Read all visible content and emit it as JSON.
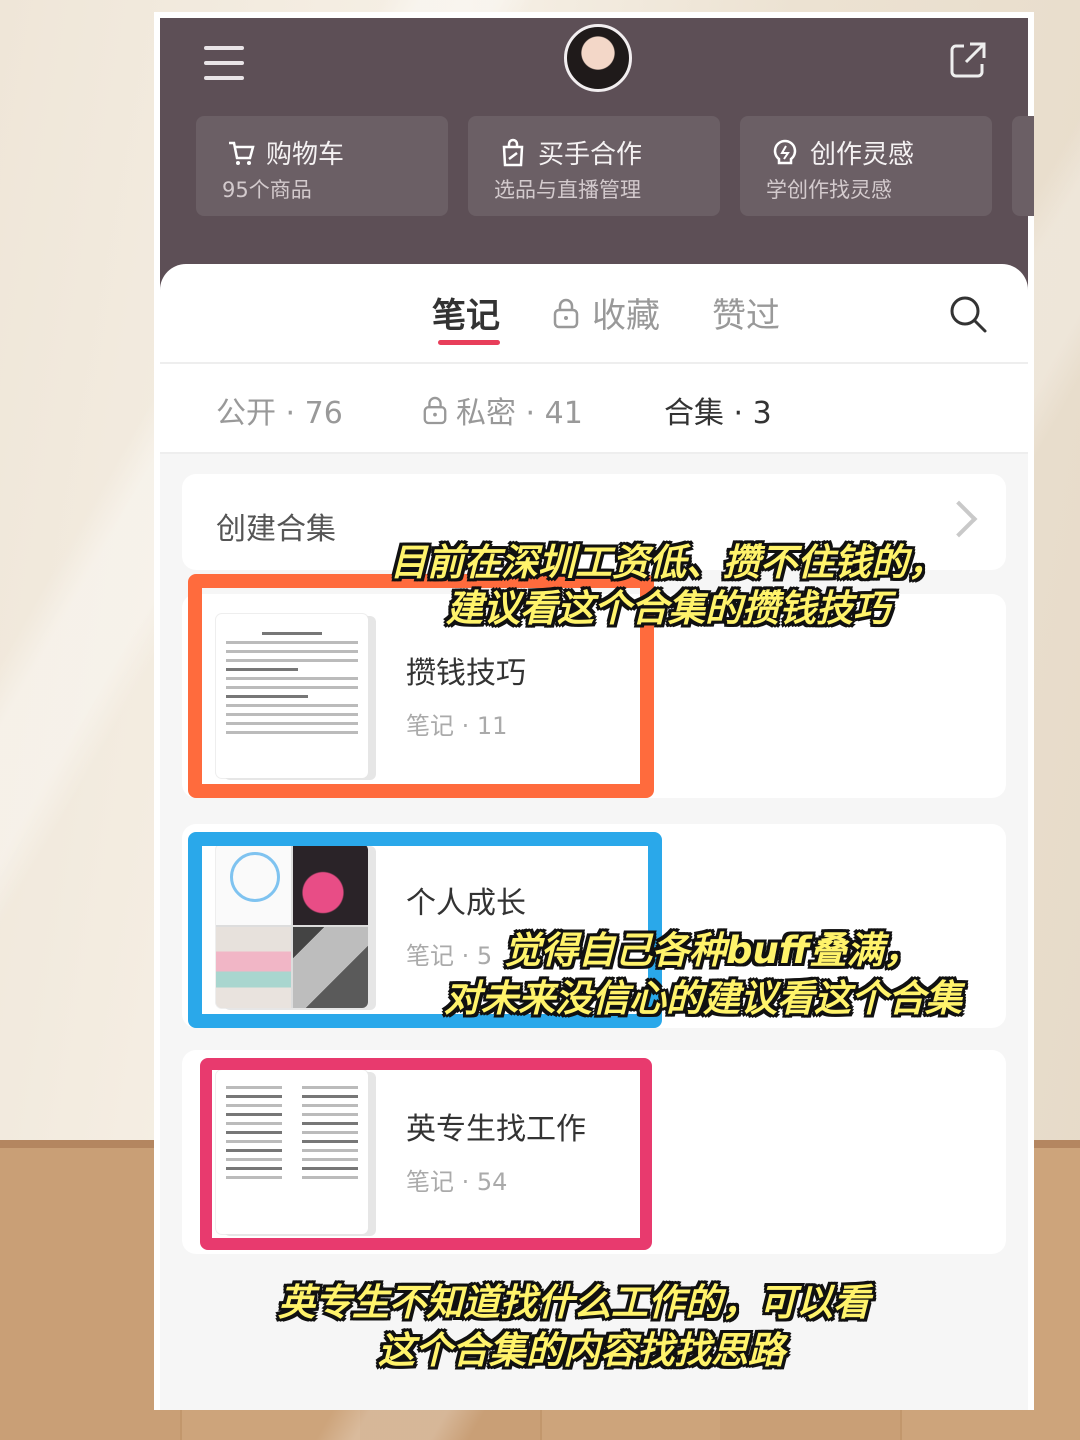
{
  "header": {
    "quick_cards": [
      {
        "title": "购物车",
        "subtitle": "95个商品",
        "icon": "cart-icon"
      },
      {
        "title": "买手合作",
        "subtitle": "选品与直播管理",
        "icon": "bag-icon"
      },
      {
        "title": "创作灵感",
        "subtitle": "学创作找灵感",
        "icon": "lightbulb-icon"
      }
    ]
  },
  "tabs": {
    "notes": "笔记",
    "favorites": "收藏",
    "likes": "赞过"
  },
  "filters": {
    "public": "公开 · 76",
    "private": "私密 · 41",
    "collections": "合集 · 3"
  },
  "create_collection": "创建合集",
  "collections": [
    {
      "title": "攒钱技巧",
      "count": "笔记 · 11"
    },
    {
      "title": "个人成长",
      "count": "笔记 · 5"
    },
    {
      "title": "英专生找工作",
      "count": "笔记 · 54"
    }
  ],
  "captions": {
    "c1_line1": "目前在深圳工资低、攒不住钱的，",
    "c1_line2": "建议看这个合集的攒钱技巧",
    "c2_line1": "觉得自己各种buff叠满，",
    "c2_line2": "对未来没信心的建议看这个合集",
    "c3_line1": "英专生不知道找什么工作的，可以看",
    "c3_line2": "这个合集的内容找找思路"
  },
  "colors": {
    "accent": "#e83e5a",
    "header_bg": "#5d4f56",
    "orange": "#ff6b3d",
    "blue": "#2aa8ea",
    "pink": "#e83a6e",
    "caption": "#fff36b"
  }
}
